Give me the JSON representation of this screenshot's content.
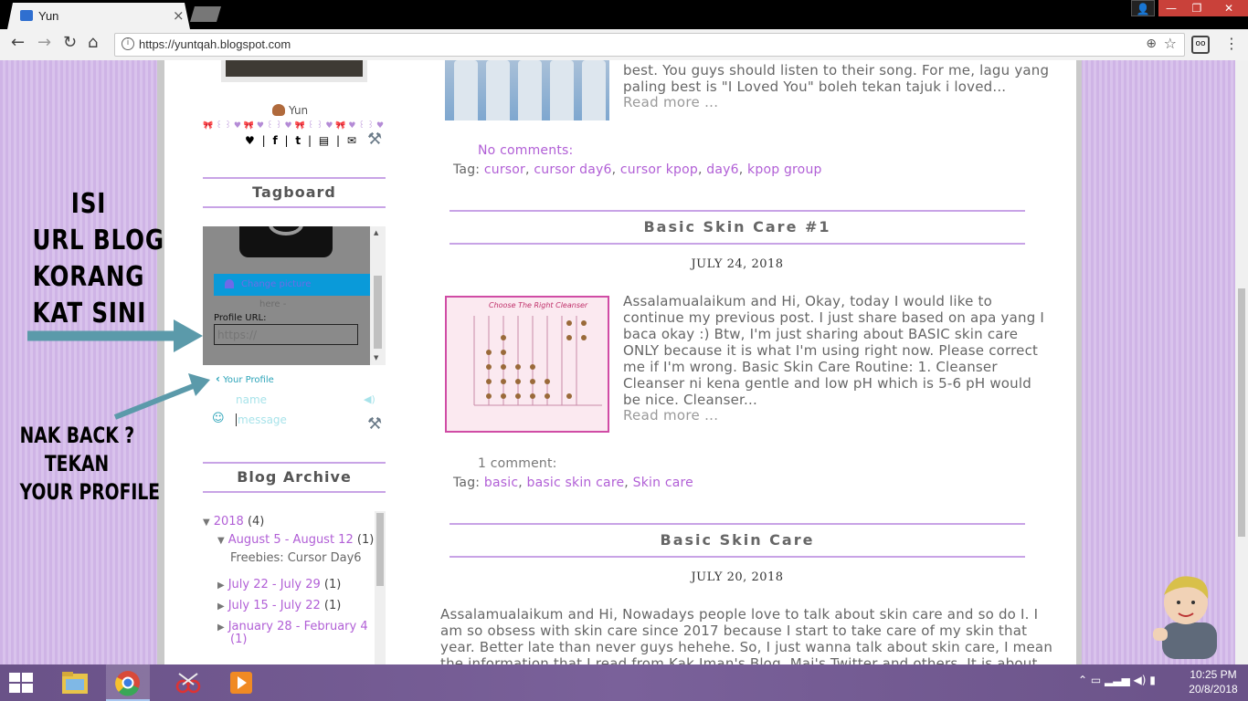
{
  "browser": {
    "tab_title": "Yun",
    "tab_close": "×",
    "url": "https://yuntqah.blogspot.com",
    "back": "←",
    "forward": "→",
    "reload": "↻",
    "home": "⌂",
    "menu": "⋮",
    "win_min": "—",
    "win_max": "❐",
    "win_close": "✕"
  },
  "sidebar": {
    "profile_name": "Yun",
    "bow_row": "🎀 ꒰ ꒱ ♥ 🎀 ♥ ꒰ ꒱ ♥ 🎀 ꒰ ꒱ ♥ 🎀 ♥ ꒰ ꒱ ♥ 🎀 ꒰ ꒱ 🎀",
    "social_icons": [
      "♥",
      "|",
      "f",
      "|",
      "t",
      "|",
      "▤",
      "|",
      "✉"
    ],
    "tagboard_heading": "Tagboard",
    "tagboard": {
      "change_picture": "Change picture",
      "here": "here -",
      "profile_url_label": "Profile URL:",
      "profile_url_placeholder": "https://",
      "your_profile": "Your Profile",
      "name_placeholder": "name",
      "message_placeholder": "message"
    },
    "archive_heading": "Blog Archive",
    "archive": {
      "year": {
        "label": "2018",
        "count": "(4)"
      },
      "open_month": {
        "label": "August 5 - August 12",
        "count": "(1)"
      },
      "open_month_post": "Freebies: Cursor Day6",
      "months": [
        {
          "label": "July 22 - July 29",
          "count": "(1)"
        },
        {
          "label": "July 15 - July 22",
          "count": "(1)"
        },
        {
          "label": "January 28 - February 4",
          "count": "(1)"
        }
      ]
    }
  },
  "annotations": {
    "isi_lines": [
      "ISI",
      "URL BLOG",
      "KORANG",
      "KAT SINI"
    ],
    "back_lines": [
      "NAK BACK ?",
      "TEKAN",
      "YOUR PROFILE"
    ]
  },
  "posts": {
    "top_excerpt_lines": [
      "best. You guys should listen to their song. For me, lagu yang",
      "paling best is \"I Loved You\" boleh tekan tajuk i loved..."
    ],
    "read_more": "Read more ...",
    "top_comments": "No comments:",
    "tag_label": "Tag:",
    "top_tags": [
      "cursor",
      "cursor day6",
      "cursor kpop",
      "day6",
      "kpop group"
    ],
    "post1": {
      "title": "Basic Skin Care #1",
      "date": "JULY 24, 2018",
      "excerpt_lines": [
        "Assalamualaikum and Hi, Okay, today I would like to",
        "continue my previous post. I just share based on apa yang I",
        "baca okay :) Btw, I'm just sharing about BASIC skin care",
        "ONLY because it is what I'm using right now. Please correct",
        "me if I'm wrong. Basic Skin Care Routine: 1. Cleanser",
        "Cleanser ni kena gentle and low pH which is 5-6 pH would",
        "be nice. Cleanser..."
      ],
      "comments": "1 comment:",
      "tags": [
        "basic",
        "basic skin care",
        "Skin care"
      ],
      "image_title": "Choose The Right Cleanser"
    },
    "post2": {
      "title": "Basic Skin Care",
      "date": "JULY 20, 2018",
      "excerpt_lines": [
        "Assalamualaikum and Hi, Nowadays people love to talk about skin care and so do I. I",
        "am so obsess with skin care since 2017 because I start to take care of my skin that",
        "year. Better late than never guys hehehe. So, I just wanna talk about skin care, I mean",
        "the information that I read from Kak Iman's Blog, Mai's Twitter and others. It is about"
      ]
    }
  },
  "taskbar": {
    "time": "10:25 PM",
    "date": "20/8/2018",
    "tray": "⌃  ▭  ▂▃▅  ◀)  ▮"
  },
  "colors": {
    "accent_purple": "#b15fd6",
    "heading_border": "#c8a3e6",
    "tag_blue": "#0a9ad9",
    "arrow_teal": "#5b9aaa"
  }
}
